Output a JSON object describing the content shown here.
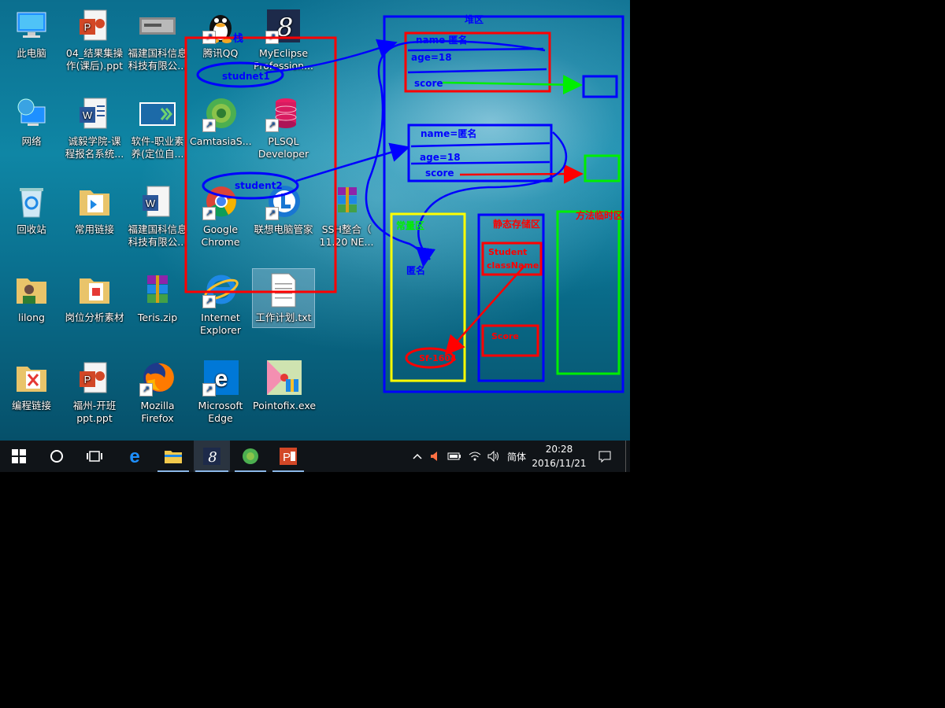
{
  "desktop": {
    "icons": [
      {
        "id": "this-pc",
        "label": "此电脑"
      },
      {
        "id": "ppt-result",
        "label": "04_结果集操\n作(课后).ppt"
      },
      {
        "id": "fjgk-1",
        "label": "福建国科信息\n科技有限公..."
      },
      {
        "id": "qq",
        "label": "腾讯QQ"
      },
      {
        "id": "myeclipse",
        "label": "MyEclipse\nProfession..."
      },
      {
        "id": "network",
        "label": "网络"
      },
      {
        "id": "word-chengyi",
        "label": "诚毅学院-课\n程报名系统..."
      },
      {
        "id": "soft-vocational",
        "label": "软件-职业素\n养(定位自..."
      },
      {
        "id": "camtasia",
        "label": "CamtasiaS..."
      },
      {
        "id": "plsql",
        "label": "PLSQL\nDeveloper"
      },
      {
        "id": "recycle",
        "label": "回收站"
      },
      {
        "id": "common-links",
        "label": "常用链接"
      },
      {
        "id": "fjgk-2",
        "label": "福建国科信息\n科技有限公..."
      },
      {
        "id": "chrome",
        "label": "Google\nChrome"
      },
      {
        "id": "lenovo",
        "label": "联想电脑管家"
      },
      {
        "id": "ssh",
        "label": "SSH整合（\n11.20 NE..."
      },
      {
        "id": "lilong",
        "label": "lilong"
      },
      {
        "id": "job-analysis",
        "label": "岗位分析素材"
      },
      {
        "id": "teris",
        "label": "Teris.zip"
      },
      {
        "id": "ie",
        "label": "Internet\nExplorer"
      },
      {
        "id": "work-plan",
        "label": "工作计划.txt"
      },
      {
        "id": "coding-links",
        "label": "编程链接"
      },
      {
        "id": "ppt-fuzhou",
        "label": "福州-开班\nppt.ppt"
      },
      {
        "id": "firefox",
        "label": "Mozilla\nFirefox"
      },
      {
        "id": "edge",
        "label": "Microsoft\nEdge"
      },
      {
        "id": "pointofix",
        "label": "Pointofix.exe"
      }
    ]
  },
  "annotations": {
    "stack_label": "栈",
    "heap_label": "堆区",
    "student1": "studnet1",
    "student2": "student2",
    "obj1_name": "name 匿名",
    "obj1_age": "age=18",
    "obj1_score": "score",
    "obj2_name": "name=匿名",
    "obj2_age": "age=18",
    "obj2_score": "score",
    "constant_area": "常量区",
    "static_area": "静态存储区",
    "method_area": "方法临时区",
    "anon": "匿名",
    "sf": "Sf-1604",
    "static_student": "Student",
    "static_classname": "className",
    "static_score": "Score"
  },
  "taskbar": {
    "tray_lang": "简体",
    "time": "20:28",
    "date": "2016/11/21"
  },
  "colors": {
    "pen_red": "#ff0000",
    "pen_blue": "#0000ff",
    "pen_green": "#00ee00",
    "pen_yellow": "#ffff00",
    "taskbar_bg": "#101418"
  }
}
